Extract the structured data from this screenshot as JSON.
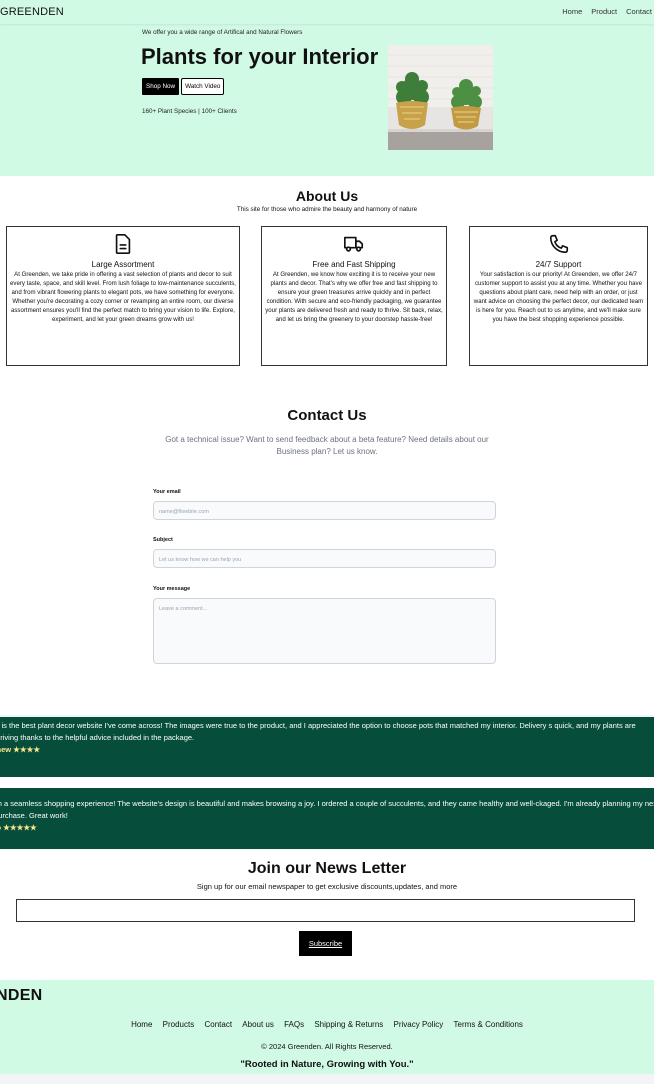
{
  "nav": {
    "brand": "GREENDEN",
    "links": [
      "Home",
      "Product",
      "Contact"
    ]
  },
  "hero": {
    "tagline": "We offer you a wide range of Artifical and Natural Flowers",
    "title": "Plants for your Interior",
    "shop_button": "Shop Now",
    "watch_button": "Watch Video",
    "stats": "160+ Plant Species | 100+ Clients"
  },
  "about": {
    "title": "About Us",
    "subtitle": "This site for those who admire the beauty and harmony of nature",
    "cards": [
      {
        "icon": "document-icon",
        "title": "Large Assortment",
        "text": "At Greenden, we take pride in offering a vast selection of plants and decor to suit every taste, space, and skill level. From lush foliage to low-maintenance succulents, and from vibrant flowering plants to elegant pots, we have something for everyone. Whether you're decorating a cozy corner or revamping an entire room, our diverse assortment ensures you'll find the perfect match to bring your vision to life. Explore, experiment, and let your green dreams grow with us!"
      },
      {
        "icon": "truck-icon",
        "title": "Free and Fast Shipping",
        "text": "At Greenden, we know how exciting it is to receive your new plants and decor. That's why we offer free and fast shipping to ensure your green treasures arrive quickly and in perfect condition. With secure and eco-friendly packaging, we guarantee your plants are delivered fresh and ready to thrive. Sit back, relax, and let us bring the greenery to your doorstep hassle-free!"
      },
      {
        "icon": "phone-icon",
        "title": "24/7 Support",
        "text": "Your satisfaction is our priority! At Greenden, we offer 24/7 customer support to assist you at any time. Whether you have questions about plant care, need help with an order, or just want advice on choosing the perfect decor, our dedicated team is here for you. Reach out to us anytime, and we'll make sure you have the best shopping experience possible."
      }
    ]
  },
  "contact": {
    "title": "Contact Us",
    "lead": "Got a technical issue? Want to send feedback about a beta feature? Need details about our Business plan? Let us know.",
    "email_label": "Your email",
    "email_placeholder": "name@flowbite.com",
    "subject_label": "Subject",
    "subject_placeholder": "Let us know how we can help you",
    "message_label": "Your message",
    "message_placeholder": "Leave a comment..."
  },
  "testimonials": [
    {
      "text": "is is the best plant decor website I've come across! The images were true to the product, and I appreciated the option to choose pots that matched my interior. Delivery s quick, and my plants are thriving thanks to the helpful advice included in the package.",
      "author": "thew ★★★★"
    },
    {
      "text": "ch a seamless shopping experience! The website's design is beautiful and makes browsing a joy. I ordered a couple of succulents, and they came healthy and well-ckaged. I'm already planning my next purchase. Great work!",
      "author": "to ★★★★★"
    }
  ],
  "newsletter": {
    "title": "Join our News Letter",
    "subtitle": "Sign up for our email newspaper to get exclusive discounts,updates, and more",
    "button": "Subscribe"
  },
  "footer": {
    "brand": "NDEN",
    "links": [
      "Home",
      "Products",
      "Contact",
      "About us",
      "FAQs",
      "Shipping & Returns",
      "Privacy Policy",
      "Terms & Conditions"
    ],
    "copyright": "© 2024 Greenden. All Rights Reserved.",
    "motto": "\"Rooted in Nature, Growing with You.\""
  },
  "colors": {
    "mint": "#d1fae5",
    "forest": "#064e3b",
    "star": "#fde68a"
  }
}
